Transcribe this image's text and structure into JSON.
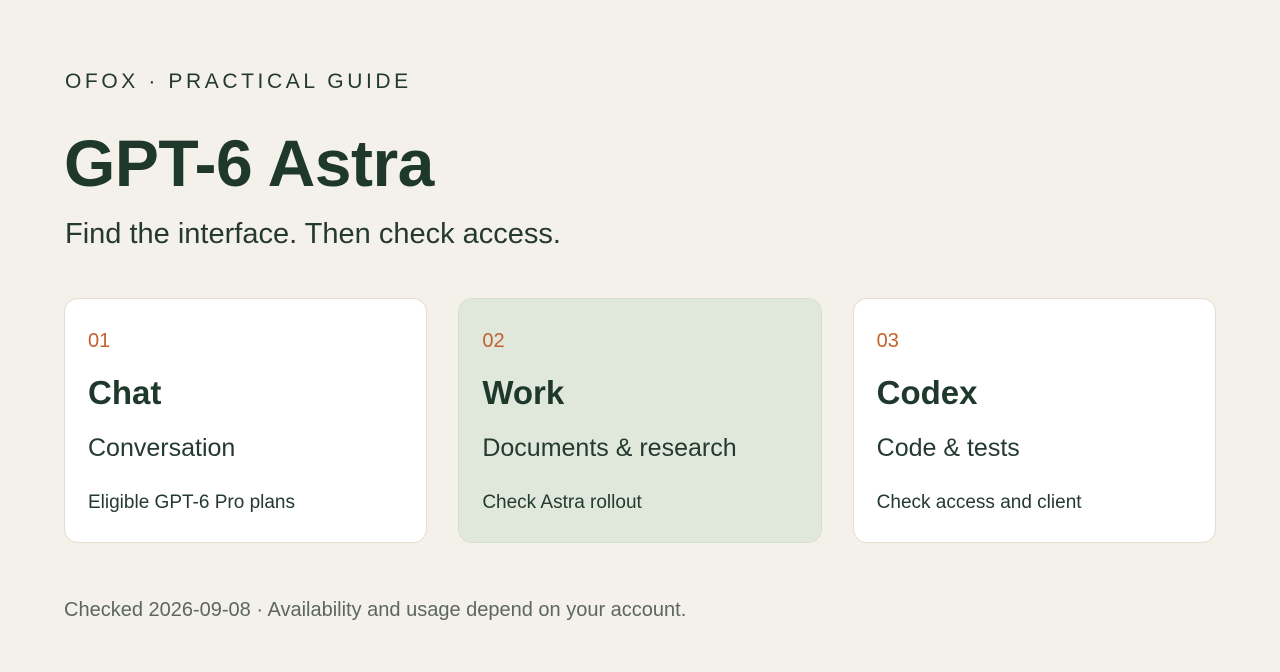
{
  "header": {
    "eyebrow": "OFOX · PRACTICAL GUIDE",
    "title": "GPT-6 Astra",
    "subtitle": "Find the interface. Then check access."
  },
  "cards": [
    {
      "number": "01",
      "title": "Chat",
      "description": "Conversation",
      "note": "Eligible GPT-6 Pro plans",
      "highlighted": false
    },
    {
      "number": "02",
      "title": "Work",
      "description": "Documents & research",
      "note": "Check Astra rollout",
      "highlighted": true
    },
    {
      "number": "03",
      "title": "Codex",
      "description": "Code & tests",
      "note": "Check access and client",
      "highlighted": false
    }
  ],
  "footer": {
    "text": "Checked 2026-09-08 · Availability and usage depend on your account."
  },
  "colors": {
    "background": "#f4f1ea",
    "text": "#1e382c",
    "accent_number": "#c2622d",
    "card_background": "#ffffff",
    "card_highlight_background": "#e0e8dc",
    "footer_text": "#5c675f"
  }
}
